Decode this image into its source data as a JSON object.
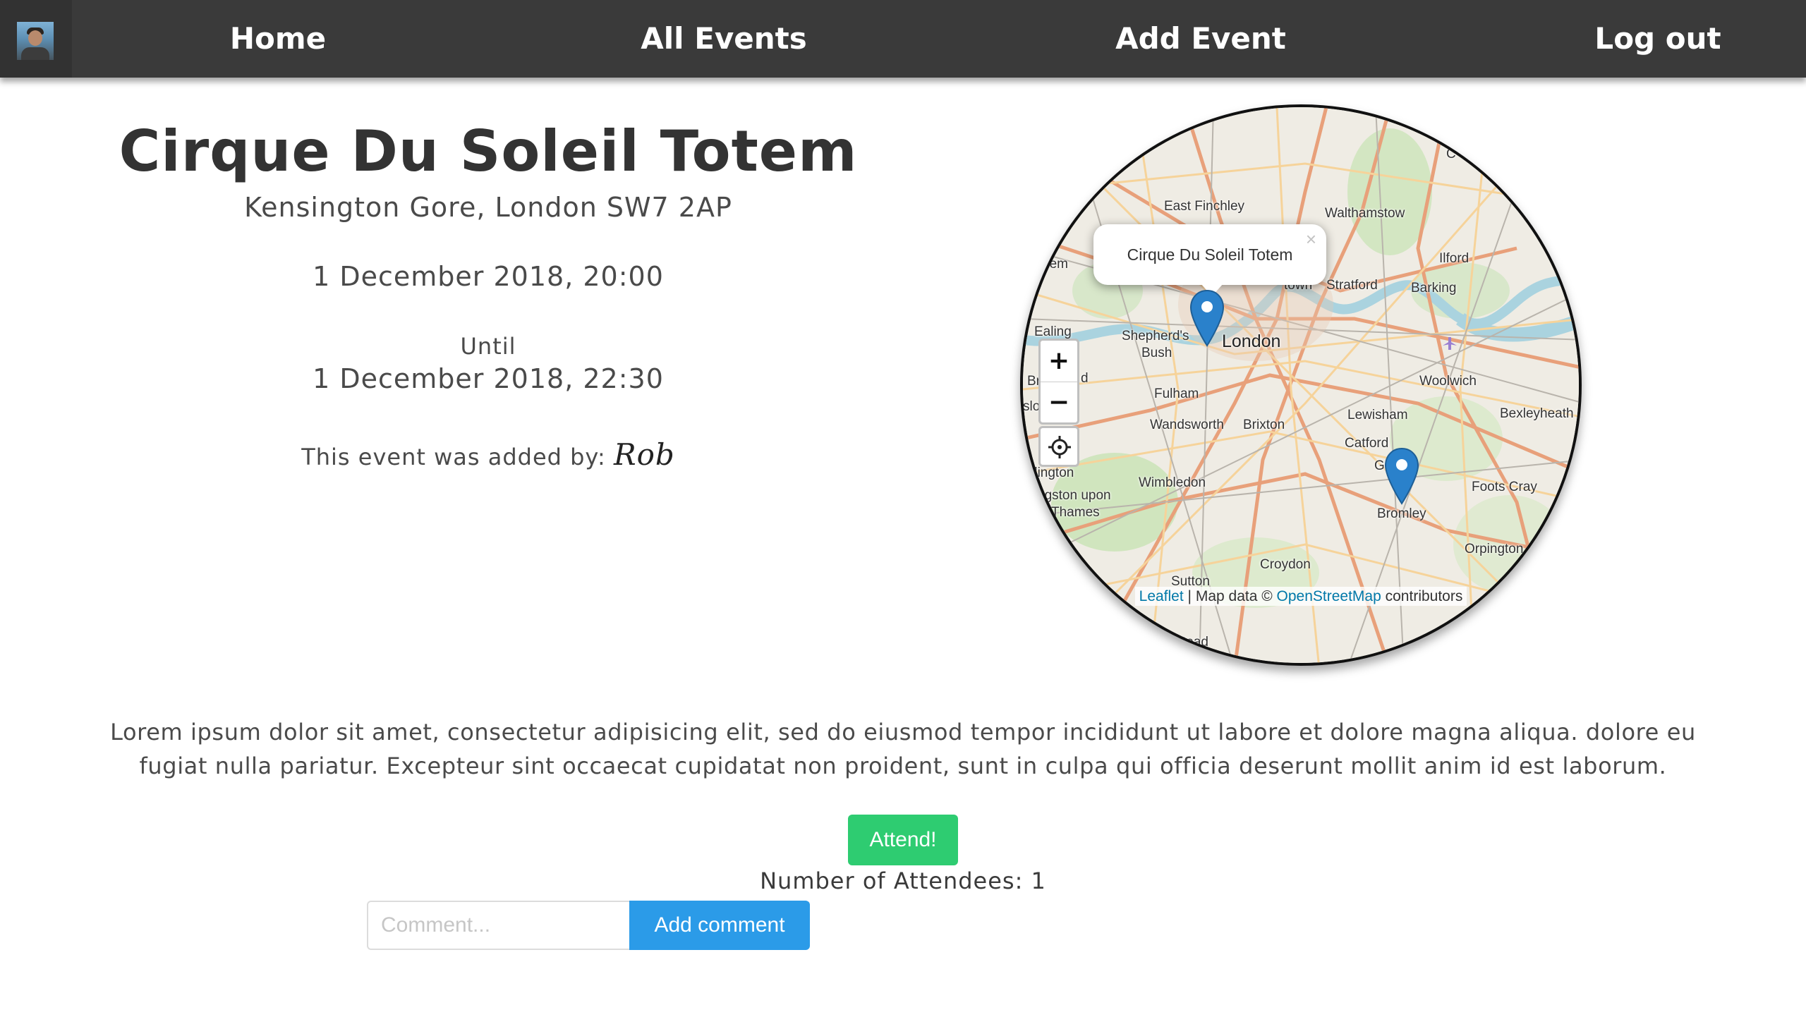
{
  "nav": {
    "home": "Home",
    "all_events": "All Events",
    "add_event": "Add Event",
    "logout": "Log out",
    "avatar_icon": "user-avatar"
  },
  "event": {
    "title": "Cirque Du Soleil Totem",
    "address": "Kensington Gore, London SW7 2AP",
    "start": "1 December 2018, 20:00",
    "until_label": "Until",
    "end": "1 December 2018, 22:30",
    "added_by_label": "This event was added by:",
    "added_by_user": "Rob",
    "description": "Lorem ipsum dolor sit amet, consectetur adipisicing elit, sed do eiusmod tempor incididunt ut labore et dolore magna aliqua. dolore eu fugiat nulla pariatur. Excepteur sint occaecat cupidatat non proident, sunt in culpa qui officia deserunt mollit anim id est laborum."
  },
  "map": {
    "popup_text": "Cirque Du Soleil Totem",
    "popup_close": "×",
    "zoom_in": "+",
    "zoom_out": "−",
    "attribution": {
      "leaflet": "Leaflet",
      "separator": " | Map data © ",
      "osm": "OpenStreetMap",
      "suffix": " contributors"
    },
    "places": {
      "east_finchley": "East Finchley",
      "walthamstow": "Walthamstow",
      "wembley": "Wem",
      "ilford": "Ilford",
      "stratford": "Stratford",
      "barking": "Barking",
      "ealing": "Ealing",
      "shepherds": "Shepherd's",
      "bush": "Bush",
      "london": "London",
      "woolwich": "Woolwich",
      "fulham": "Fulham",
      "lewisham": "Lewisham",
      "bexleyheath": "Bexleyheath",
      "wandsworth": "Wandsworth",
      "brixton": "Brixton",
      "catford": "Catford",
      "greenwich_park": "Gr     ark",
      "foots_cray": "Foots Cray",
      "wimbledon": "Wimbledon",
      "kingston1": "ngston upon",
      "kingston2": "Thames",
      "dington": "dington",
      "bromley": "Bromley",
      "orpington": "Orpington",
      "croydon": "Croydon",
      "sutton": "Sutton",
      "stead": "tead",
      "br": "Br",
      "d": "d",
      "slo": "slo",
      "town": "town",
      "c": "C"
    },
    "colors": {
      "marker": "#2a81cb",
      "water": "#aad3df",
      "park": "#c8e4b4",
      "road_major": "#e8a07a",
      "road_minor": "#f6d39a"
    }
  },
  "attend": {
    "button_label": "Attend!",
    "attendees_label": "Number of Attendees: 1"
  },
  "comment": {
    "placeholder": "Comment...",
    "value": "",
    "button_label": "Add comment"
  },
  "colors": {
    "navbar": "#3a3a3a",
    "attend_green": "#2ecc71",
    "comment_blue": "#2b9be8"
  }
}
